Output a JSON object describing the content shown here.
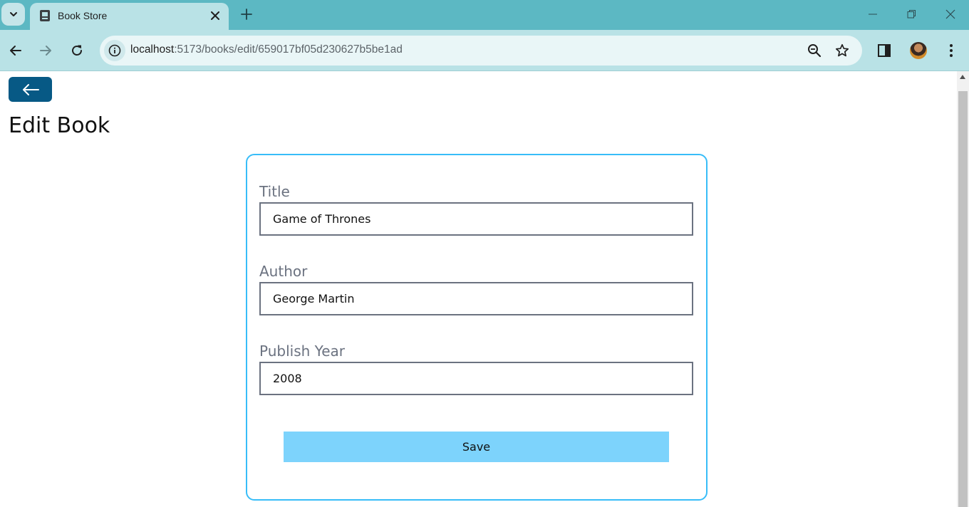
{
  "browser": {
    "tab_title": "Book Store",
    "url_host": "localhost",
    "url_rest": ":5173/books/edit/659017bf05d230627b5be1ad"
  },
  "page": {
    "title": "Edit Book"
  },
  "form": {
    "title_label": "Title",
    "title_value": "Game of Thrones",
    "author_label": "Author",
    "author_value": "George Martin",
    "year_label": "Publish Year",
    "year_value": "2008",
    "save_label": "Save"
  },
  "colors": {
    "back_button": "#075985",
    "card_border": "#38bdf8",
    "save_button": "#7dd3fc",
    "chrome_tabstrip": "#5cb8c3"
  }
}
